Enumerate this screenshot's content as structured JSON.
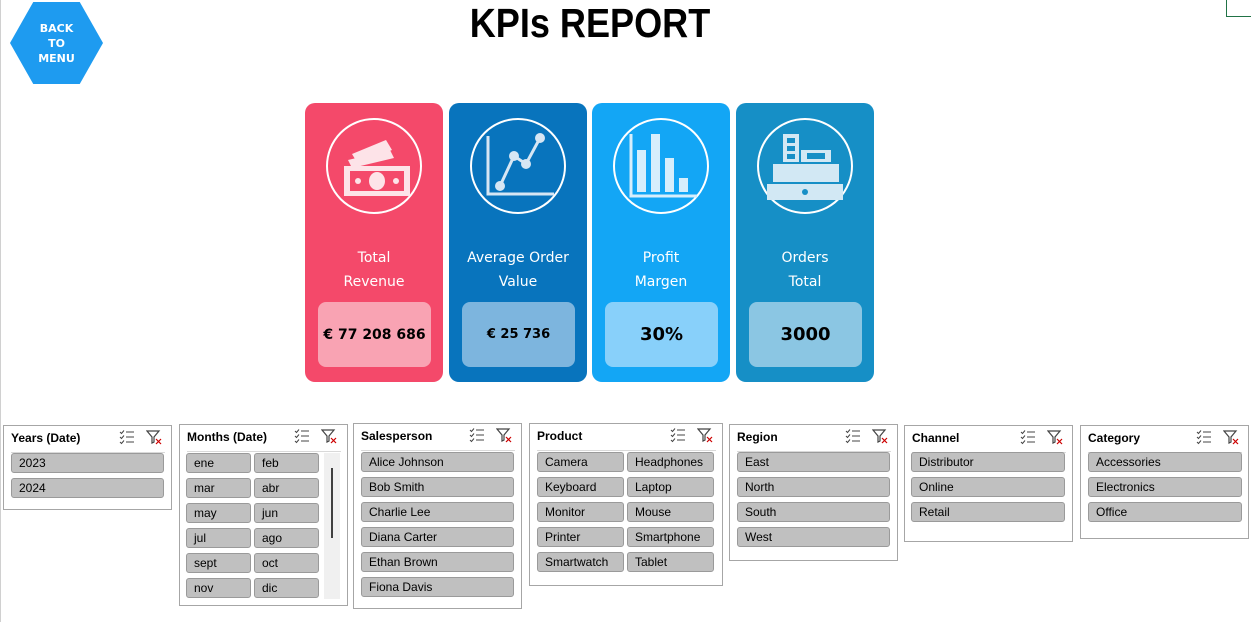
{
  "back_button": {
    "line1": "BACK",
    "line2": "TO",
    "line3": "MENU"
  },
  "page_title": "KPIs REPORT",
  "kpis": [
    {
      "label_line1": "Total",
      "label_line2": "Revenue",
      "value": "€ 77 208 686",
      "icon": "money-icon",
      "color": "#f4496a",
      "value_bg": "#f9a3b3"
    },
    {
      "label_line1": "Average Order",
      "label_line2": "Value",
      "value": "€ 25 736",
      "icon": "line-chart-icon",
      "color": "#0874bd",
      "value_bg": "#7db5de"
    },
    {
      "label_line1": "Profit",
      "label_line2": "Margen",
      "value": "30%",
      "icon": "bar-chart-icon",
      "color": "#13a6f5",
      "value_bg": "#88d0fa"
    },
    {
      "label_line1": "Orders",
      "label_line2": "Total",
      "value": "3000",
      "icon": "cash-register-icon",
      "color": "#168fc6",
      "value_bg": "#8bc6e3"
    }
  ],
  "slicers": {
    "years": {
      "title": "Years (Date)",
      "items": [
        "2023",
        "2024"
      ]
    },
    "months": {
      "title": "Months (Date)",
      "items": [
        "ene",
        "feb",
        "mar",
        "abr",
        "may",
        "jun",
        "jul",
        "ago",
        "sept",
        "oct",
        "nov",
        "dic"
      ]
    },
    "salesperson": {
      "title": "Salesperson",
      "items": [
        "Alice Johnson",
        "Bob Smith",
        "Charlie Lee",
        "Diana Carter",
        "Ethan Brown",
        "Fiona Davis"
      ]
    },
    "product": {
      "title": "Product",
      "items": [
        "Camera",
        "Headphones",
        "Keyboard",
        "Laptop",
        "Monitor",
        "Mouse",
        "Printer",
        "Smartphone",
        "Smartwatch",
        "Tablet"
      ]
    },
    "region": {
      "title": "Region",
      "items": [
        "East",
        "North",
        "South",
        "West"
      ]
    },
    "channel": {
      "title": "Channel",
      "items": [
        "Distributor",
        "Online",
        "Retail"
      ]
    },
    "category": {
      "title": "Category",
      "items": [
        "Accessories",
        "Electronics",
        "Office"
      ]
    }
  }
}
